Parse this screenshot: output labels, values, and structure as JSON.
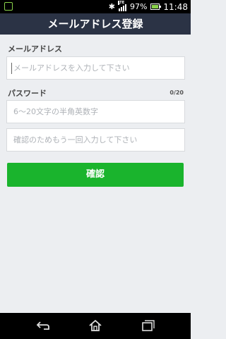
{
  "status_bar": {
    "battery_percent": "97%",
    "time": "11:48",
    "network_label": "LTE",
    "icons": [
      "notification-icon",
      "bluetooth-icon",
      "signal-icon",
      "battery-icon"
    ]
  },
  "header": {
    "title": "メールアドレス登録"
  },
  "form": {
    "email_label": "メールアドレス",
    "email_placeholder": "メールアドレスを入力して下さい",
    "password_label": "パスワード",
    "password_counter": "0/20",
    "password_placeholder": "6～20文字の半角英数字",
    "password_confirm_placeholder": "確認のためもう一回入力して下さい",
    "confirm_button": "確認"
  },
  "nav_bar": {
    "icons": [
      "back-icon",
      "home-icon",
      "recent-apps-icon"
    ]
  },
  "colors": {
    "title_bar": "#2b3345",
    "accent_green": "#1ab42d",
    "background": "#eceef1"
  }
}
